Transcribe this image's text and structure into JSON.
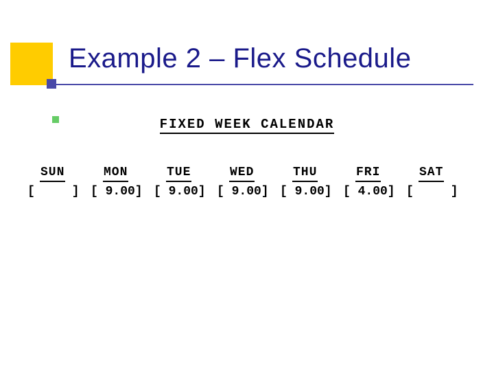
{
  "title": "Example 2 – Flex Schedule",
  "calendar": {
    "heading": "FIXED WEEK CALENDAR",
    "days": [
      {
        "label": "SUN",
        "cell": "[     ]"
      },
      {
        "label": "MON",
        "cell": "[ 9.00]"
      },
      {
        "label": "TUE",
        "cell": "[ 9.00]"
      },
      {
        "label": "WED",
        "cell": "[ 9.00]"
      },
      {
        "label": "THU",
        "cell": "[ 9.00]"
      },
      {
        "label": "FRI",
        "cell": "[ 4.00]"
      },
      {
        "label": "SAT",
        "cell": "[     ]"
      }
    ]
  }
}
